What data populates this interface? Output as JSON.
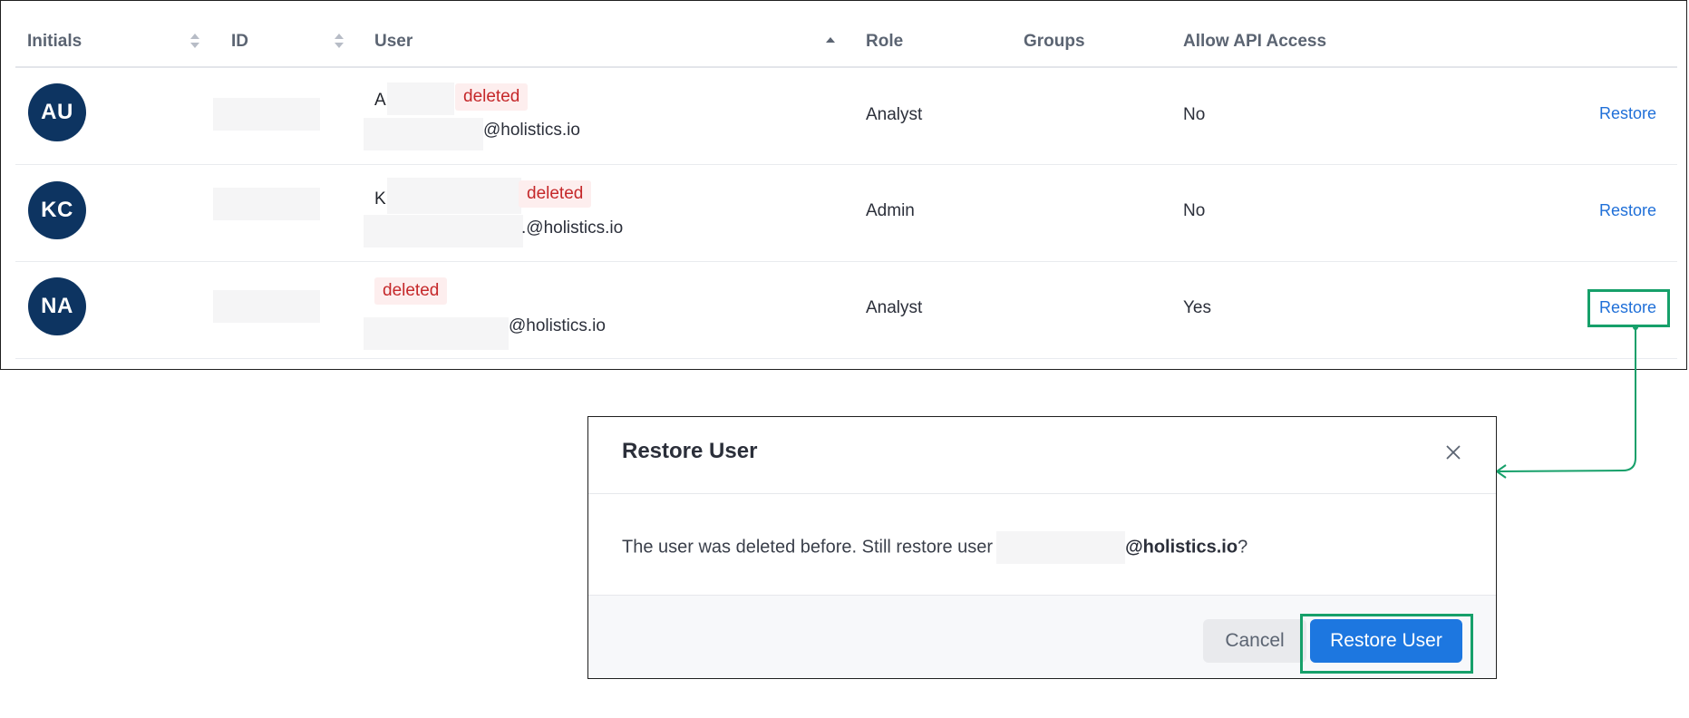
{
  "table": {
    "columns": {
      "initials": "Initials",
      "id": "ID",
      "user": "User",
      "role": "Role",
      "groups": "Groups",
      "api_access": "Allow API Access"
    },
    "rows": [
      {
        "initials": "AU",
        "name_prefix": "A",
        "status": "deleted",
        "email_domain": "@holistics.io",
        "role": "Analyst",
        "groups": "",
        "api_access": "No",
        "action": "Restore"
      },
      {
        "initials": "KC",
        "name_prefix": "K",
        "status": "deleted",
        "email_domain": ".@holistics.io",
        "role": "Admin",
        "groups": "",
        "api_access": "No",
        "action": "Restore"
      },
      {
        "initials": "NA",
        "name_prefix": "",
        "status": "deleted",
        "email_domain": "@holistics.io",
        "role": "Analyst",
        "groups": "",
        "api_access": "Yes",
        "action": "Restore"
      }
    ]
  },
  "modal": {
    "title": "Restore User",
    "body_text": "The user was deleted before. Still restore user",
    "body_domain": "@holistics.io",
    "body_suffix": "?",
    "cancel_label": "Cancel",
    "confirm_label": "Restore User"
  },
  "colors": {
    "accent": "#1d77e0",
    "highlight": "#16a06a",
    "avatar": "#0d3461",
    "deleted_badge_text": "#c5282a"
  }
}
